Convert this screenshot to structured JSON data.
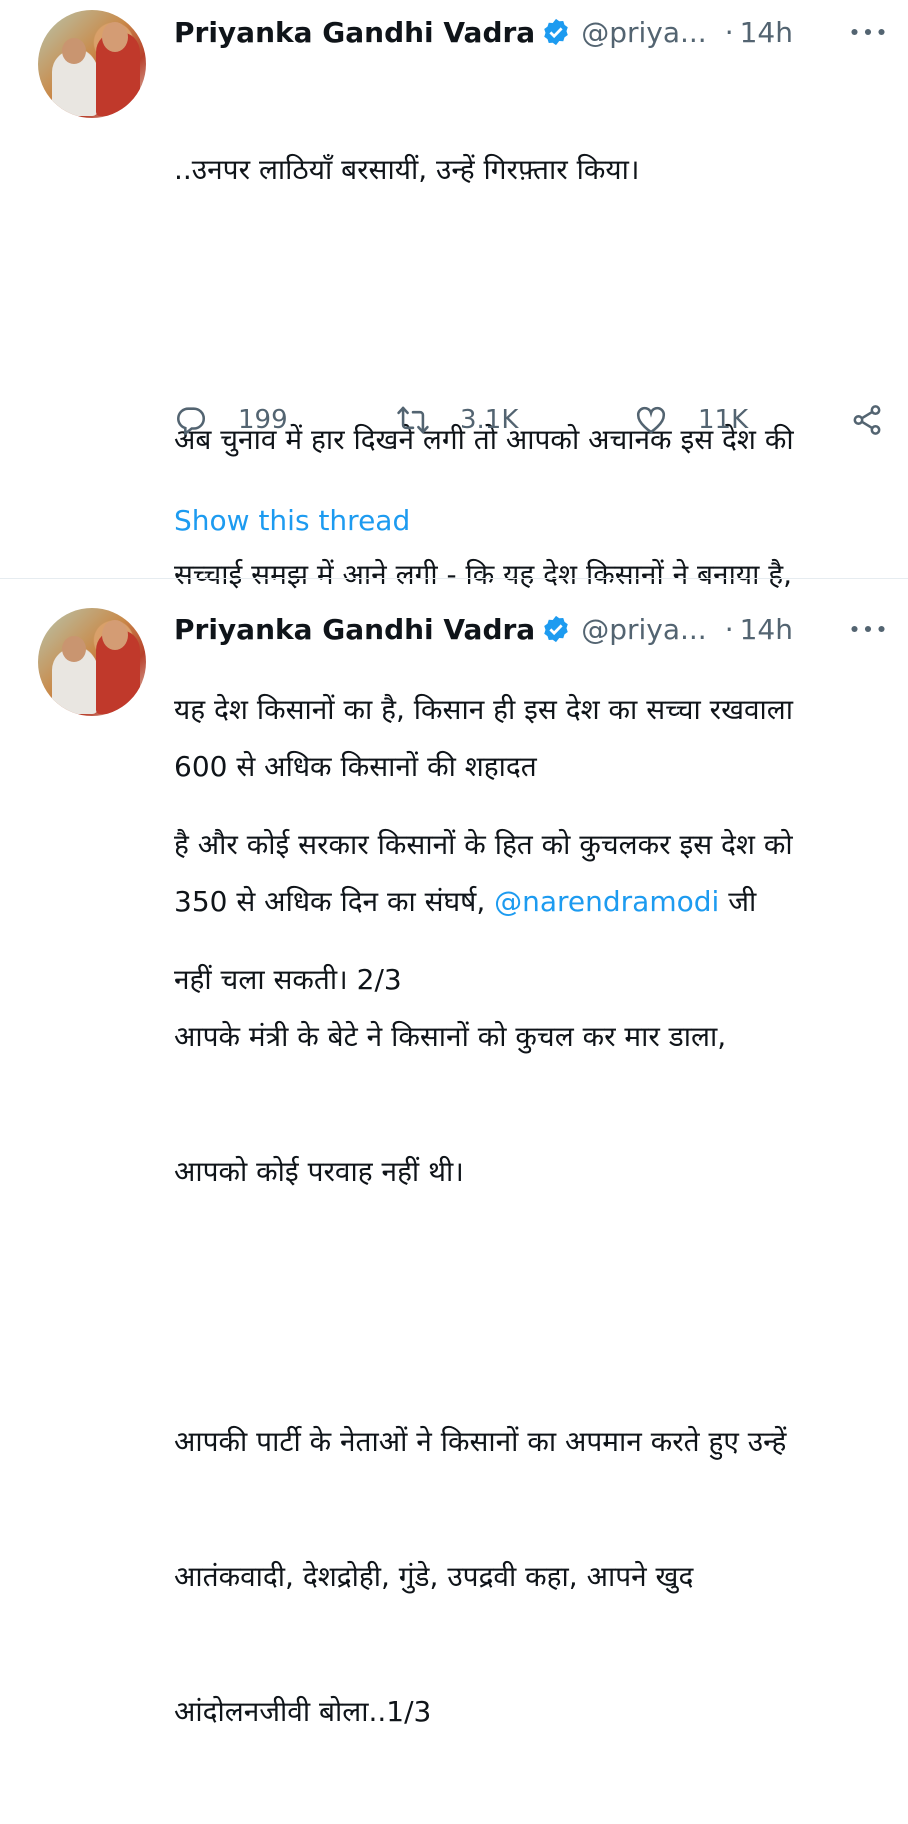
{
  "tweets": [
    {
      "author": {
        "name": "Priyanka Gandhi Vadra",
        "handle": "@priya...",
        "separator": "·",
        "time": "14h"
      },
      "lines": [
        "..उनपर लाठियाँ बरसायीं, उन्हें गिरफ़्तार किया।",
        "",
        "अब चुनाव में हार दिखने लगी तो आपको अचानक इस देश की",
        "सच्चाई समझ में आने लगी - कि यह देश किसानों ने बनाया है,",
        "यह देश किसानों का है, किसान ही इस देश का सच्चा रखवाला",
        "है और कोई सरकार किसानों के हित को कुचलकर इस देश को",
        "नहीं चला सकती। 2/3"
      ],
      "stats": {
        "replies": "199",
        "retweets": "3.1K",
        "likes": "11K"
      },
      "show_thread": "Show this thread"
    },
    {
      "author": {
        "name": "Priyanka Gandhi Vadra",
        "handle": "@priya...",
        "separator": "·",
        "time": "14h"
      },
      "line1": "600 से अधिक किसानों की शहादत",
      "line2_pre": "350 से अधिक दिन का संघर्ष, ",
      "line2_mention": "@narendramodi",
      "line2_post": " जी",
      "line3": "आपके मंत्री के बेटे ने किसानों को कुचल कर मार डाला,",
      "line4": "आपको कोई परवाह नहीं थी।",
      "line6": "आपकी पार्टी के नेताओं ने किसानों का अपमान करते हुए उन्हें",
      "line7": "आतंकवादी, देशद्रोही, गुंडे, उपद्रवी कहा, आपने खुद",
      "line8": "आंदोलनजीवी बोला..1/3"
    }
  ],
  "colors": {
    "accent": "#1d9bf0",
    "muted": "#536471",
    "text": "#0f1419"
  },
  "icons": [
    "verified-badge-icon",
    "more-icon",
    "reply-icon",
    "retweet-icon",
    "like-icon",
    "share-icon"
  ]
}
